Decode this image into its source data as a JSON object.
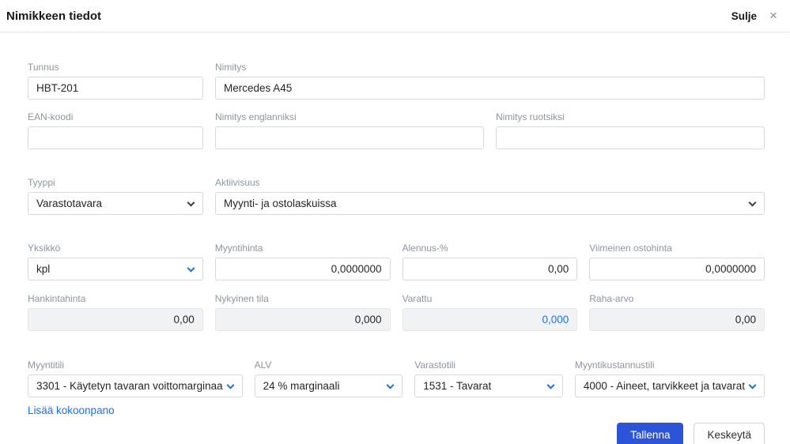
{
  "colors": {
    "primary_button_blue": "#2b54d9",
    "link_blue": "#1a73e8",
    "label_gray": "#8e959f",
    "input_border": "#d6d9de",
    "disabled_bg": "#f1f2f4"
  },
  "header": {
    "title": "Nimikkeen tiedot",
    "close_label": "Sulje"
  },
  "icons": {
    "close": "×"
  },
  "fields": {
    "tunnus": {
      "label": "Tunnus",
      "value": "HBT-201"
    },
    "nimitys": {
      "label": "Nimitys",
      "value": "Mercedes A45"
    },
    "ean": {
      "label": "EAN-koodi",
      "value": ""
    },
    "nimitys_en": {
      "label": "Nimitys englanniksi",
      "value": ""
    },
    "nimitys_sv": {
      "label": "Nimitys ruotsiksi",
      "value": ""
    },
    "tyyppi": {
      "label": "Tyyppi",
      "value": "Varastotavara"
    },
    "aktiivisuus": {
      "label": "Aktiivisuus",
      "value": "Myynti- ja ostolaskuissa"
    },
    "yksikko": {
      "label": "Yksikkö",
      "value": "kpl"
    },
    "myyntihinta": {
      "label": "Myyntihinta",
      "value": "0,0000000"
    },
    "alennus": {
      "label": "Alennus-%",
      "value": "0,00"
    },
    "viimeinen_ostohinta": {
      "label": "Viimeinen ostohinta",
      "value": "0,0000000"
    },
    "hankintahinta": {
      "label": "Hankintahinta",
      "value": "0,00"
    },
    "nykyinen_tila": {
      "label": "Nykyinen tila",
      "value": "0,000"
    },
    "varattu": {
      "label": "Varattu",
      "value": "0,000"
    },
    "raha_arvo": {
      "label": "Raha-arvo",
      "value": "0,00"
    },
    "myyntitili": {
      "label": "Myyntitili",
      "value": "3301 - Käytetyn tavaran voittomarginaa"
    },
    "alv": {
      "label": "ALV",
      "value": "24 % marginaali"
    },
    "varastotili": {
      "label": "Varastotili",
      "value": "1531 - Tavarat"
    },
    "myyntikustannustili": {
      "label": "Myyntikustannustili",
      "value": "4000 - Aineet, tarvikkeet ja tavarat"
    }
  },
  "link": {
    "lisaa_kokoonpano": "Lisää kokoonpano"
  },
  "buttons": {
    "save": "Tallenna",
    "cancel": "Keskeytä"
  }
}
